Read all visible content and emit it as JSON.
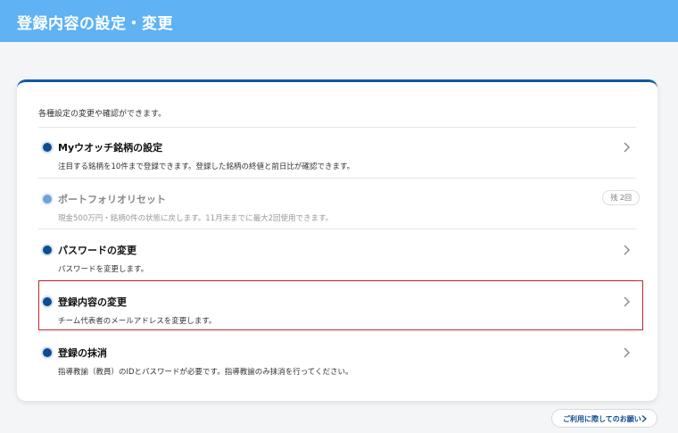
{
  "header": {
    "title": "登録内容の設定・変更"
  },
  "card": {
    "intro": "各種設定の変更や確認ができます。",
    "items": [
      {
        "title": "Myウオッチ銘柄の設定",
        "desc": "注目する銘柄を10件まで登録できます。登録した銘柄の終値と前日比が確認できます。"
      },
      {
        "title": "ポートフォリオリセット",
        "desc": "現金500万円・銘柄0件の状態に戻します。11月末までに最大2回使用できます。",
        "badge": "残 2回"
      },
      {
        "title": "パスワードの変更",
        "desc": "パスワードを変更します。"
      },
      {
        "title": "登録内容の変更",
        "desc": "チーム代表者のメールアドレスを変更します。"
      },
      {
        "title": "登録の抹消",
        "desc": "指導教諭（教員）のIDとパスワードが必要です。指導教諭のみ抹消を行ってください。"
      }
    ]
  },
  "footer": {
    "guide_label": "ご利用に際してのお願い"
  },
  "colors": {
    "header": "#5fb2f3",
    "accent": "#0e4d92",
    "highlight": "#c0282d"
  },
  "icons": {
    "chevron": "chevron-right-icon",
    "bullet": "bullet-dot-icon"
  }
}
